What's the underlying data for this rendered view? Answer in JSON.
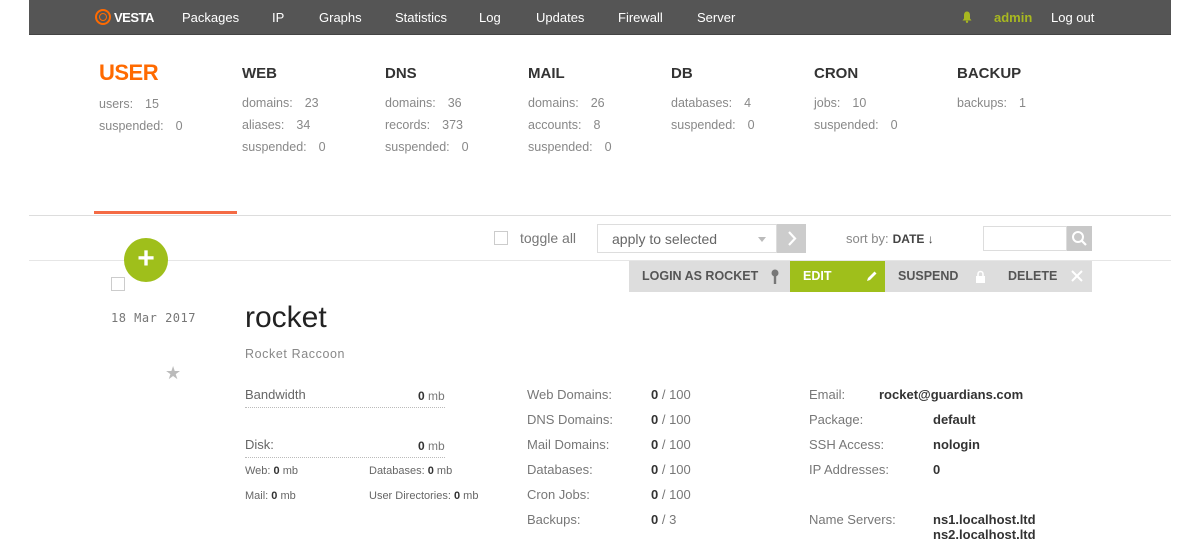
{
  "nav": {
    "logo_text": "VESTA",
    "items": [
      "Packages",
      "IP",
      "Graphs",
      "Statistics",
      "Log",
      "Updates",
      "Firewall",
      "Server"
    ],
    "user": "admin",
    "logout": "Log out"
  },
  "stats": {
    "user": {
      "title": "USER",
      "rows": [
        {
          "label": "users:",
          "value": "15"
        },
        {
          "label": "suspended:",
          "value": "0"
        }
      ]
    },
    "web": {
      "title": "WEB",
      "rows": [
        {
          "label": "domains:",
          "value": "23"
        },
        {
          "label": "aliases:",
          "value": "34"
        },
        {
          "label": "suspended:",
          "value": "0"
        }
      ]
    },
    "dns": {
      "title": "DNS",
      "rows": [
        {
          "label": "domains:",
          "value": "36"
        },
        {
          "label": "records:",
          "value": "373"
        },
        {
          "label": "suspended:",
          "value": "0"
        }
      ]
    },
    "mail": {
      "title": "MAIL",
      "rows": [
        {
          "label": "domains:",
          "value": "26"
        },
        {
          "label": "accounts:",
          "value": "8"
        },
        {
          "label": "suspended:",
          "value": "0"
        }
      ]
    },
    "db": {
      "title": "DB",
      "rows": [
        {
          "label": "databases:",
          "value": "4"
        },
        {
          "label": "suspended:",
          "value": "0"
        }
      ]
    },
    "cron": {
      "title": "CRON",
      "rows": [
        {
          "label": "jobs:",
          "value": "10"
        },
        {
          "label": "suspended:",
          "value": "0"
        }
      ]
    },
    "backup": {
      "title": "BACKUP",
      "rows": [
        {
          "label": "backups:",
          "value": "1"
        }
      ]
    }
  },
  "toolbar": {
    "toggle_all": "toggle all",
    "apply_selected": "apply to selected",
    "sort_by": "sort by:",
    "sort_field": "DATE ↓",
    "search_placeholder": ""
  },
  "actions": {
    "login_as": "LOGIN AS ROCKET",
    "edit": "EDIT",
    "suspend": "SUSPEND",
    "delete": "DELETE"
  },
  "user": {
    "date": "18  Mar  2017",
    "name": "rocket",
    "full_name": "Rocket Raccoon",
    "bandwidth_label": "Bandwidth",
    "bandwidth_value": "0",
    "disk_label": "Disk:",
    "disk_value": "0",
    "unit": "mb",
    "web_label": "Web:",
    "web_value": "0",
    "databases_label": "Databases:",
    "databases_value": "0",
    "mail_label": "Mail:",
    "mail_value": "0",
    "userdirs_label": "User Directories:",
    "userdirs_value": "0"
  },
  "limits": [
    {
      "label": "Web Domains:",
      "used": "0",
      "limit": " / 100"
    },
    {
      "label": "DNS Domains:",
      "used": "0",
      "limit": " / 100"
    },
    {
      "label": "Mail Domains:",
      "used": "0",
      "limit": " / 100"
    },
    {
      "label": "Databases:",
      "used": "0",
      "limit": " / 100"
    },
    {
      "label": "Cron Jobs:",
      "used": "0",
      "limit": " / 100"
    },
    {
      "label": "Backups:",
      "used": "0",
      "limit": " / 3"
    }
  ],
  "info": {
    "email_label": "Email:",
    "email": "rocket@guardians.com",
    "package_label": "Package:",
    "package": "default",
    "ssh_label": "SSH Access:",
    "ssh": "nologin",
    "ip_label": "IP Addresses:",
    "ip": "0",
    "ns_label": "Name Servers:",
    "ns1": "ns1.localhost.ltd",
    "ns2": "ns2.localhost.ltd"
  },
  "colors": {
    "accent": "#ff6a00",
    "green": "#9fbf1b",
    "topbar": "#555555"
  }
}
